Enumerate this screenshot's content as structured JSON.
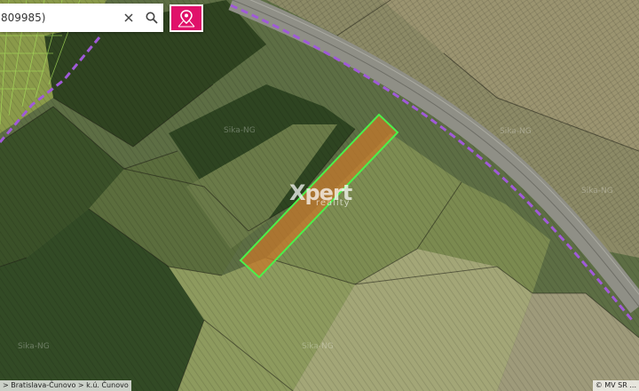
{
  "search": {
    "value": "809985)"
  },
  "buttons": {
    "clear_icon": "close-icon",
    "search_icon": "search-icon",
    "pin_icon": "map-pin-icon"
  },
  "logo": {
    "main": "Xpert",
    "sub": "reality"
  },
  "watermark": "Sika-NG",
  "breadcrumb": "> Bratislava-Čunovo > k.ú. Čunovo",
  "attribution": "© MV SR ...",
  "colors": {
    "accent": "#e0116a",
    "parcel_outline": "#4cf04a",
    "parcel_fill": "#c9792a",
    "cadastre_boundary": "#a05ad8"
  }
}
